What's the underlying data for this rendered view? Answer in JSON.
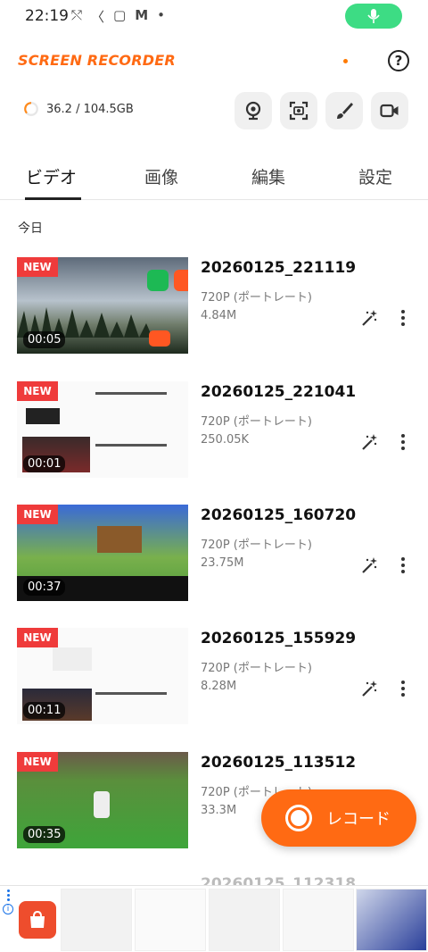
{
  "status_bar": {
    "time": "22:19"
  },
  "header": {
    "app_title": "SCREEN RECORDER",
    "help_symbol": "?"
  },
  "storage": {
    "used_text": "36.2 / 104.5GB"
  },
  "tabs": [
    {
      "label": "ビデオ",
      "active": true
    },
    {
      "label": "画像",
      "active": false
    },
    {
      "label": "編集",
      "active": false
    },
    {
      "label": "設定",
      "active": false
    }
  ],
  "section_date": "今日",
  "videos": [
    {
      "name": "20260125_221119",
      "resolution": "720P (ポートレート)",
      "size": "4.84M",
      "duration": "00:05",
      "badge": "NEW"
    },
    {
      "name": "20260125_221041",
      "resolution": "720P (ポートレート)",
      "size": "250.05K",
      "duration": "00:01",
      "badge": "NEW"
    },
    {
      "name": "20260125_160720",
      "resolution": "720P (ポートレート)",
      "size": "23.75M",
      "duration": "00:37",
      "badge": "NEW"
    },
    {
      "name": "20260125_155929",
      "resolution": "720P (ポートレート)",
      "size": "8.28M",
      "duration": "00:11",
      "badge": "NEW"
    },
    {
      "name": "20260125_113512",
      "resolution": "720P (ポートレート)",
      "size": "33.3M",
      "duration": "00:35",
      "badge": "NEW"
    }
  ],
  "partial_next_name": "20260125_112318",
  "record_button": {
    "label": "レコード"
  },
  "colors": {
    "accent": "#ff6a13",
    "badge": "#ef3b3b",
    "mic_pill": "#3ddc84"
  }
}
